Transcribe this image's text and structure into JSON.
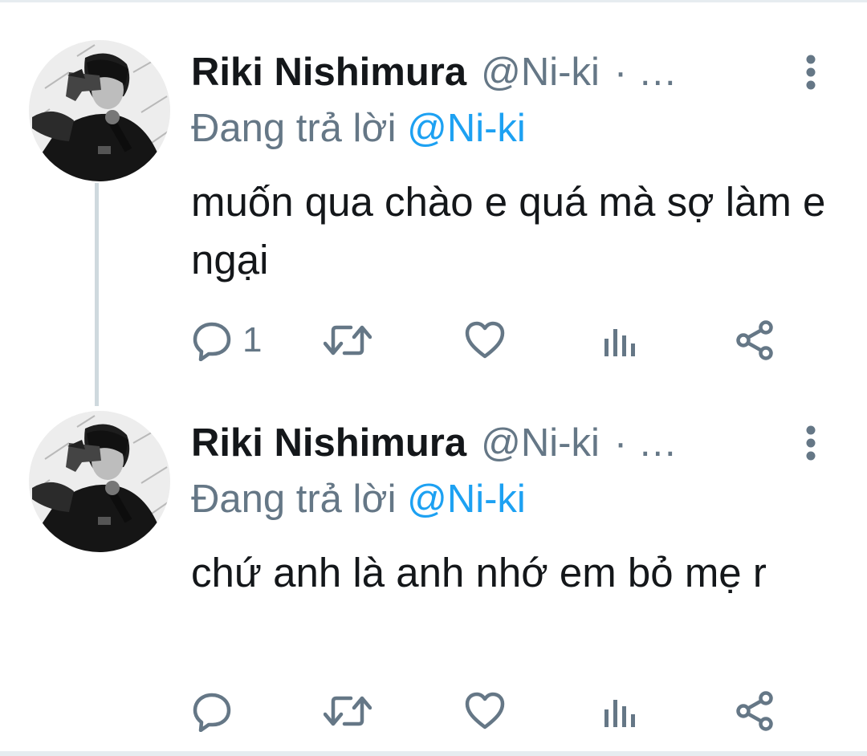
{
  "tweets": [
    {
      "display_name": "Riki Nishimura",
      "handle": "@Ni-ki",
      "header_truncation": "· …",
      "reply_prefix": "Đang trả lời",
      "reply_handle": "@Ni-ki",
      "text": "muốn qua chào e quá mà sợ làm e ngại",
      "reply_count": "1",
      "avatar_icon": "profile-photo-icon"
    },
    {
      "display_name": "Riki Nishimura",
      "handle": "@Ni-ki",
      "header_truncation": "· …",
      "reply_prefix": "Đang trả lời",
      "reply_handle": "@Ni-ki",
      "text": "chứ anh là anh nhớ em bỏ mẹ r",
      "reply_count": "",
      "avatar_icon": "profile-photo-icon"
    }
  ],
  "icons": {
    "more": "more-vertical-icon",
    "reply": "reply-bubble-icon",
    "retweet": "retweet-icon",
    "like": "heart-icon",
    "stats": "analytics-icon",
    "share": "share-icon"
  },
  "colors": {
    "text": "#14171a",
    "secondary": "#657786",
    "link": "#1da1f2",
    "thread_line": "#cfd9de",
    "divider": "#e6ecf0"
  }
}
